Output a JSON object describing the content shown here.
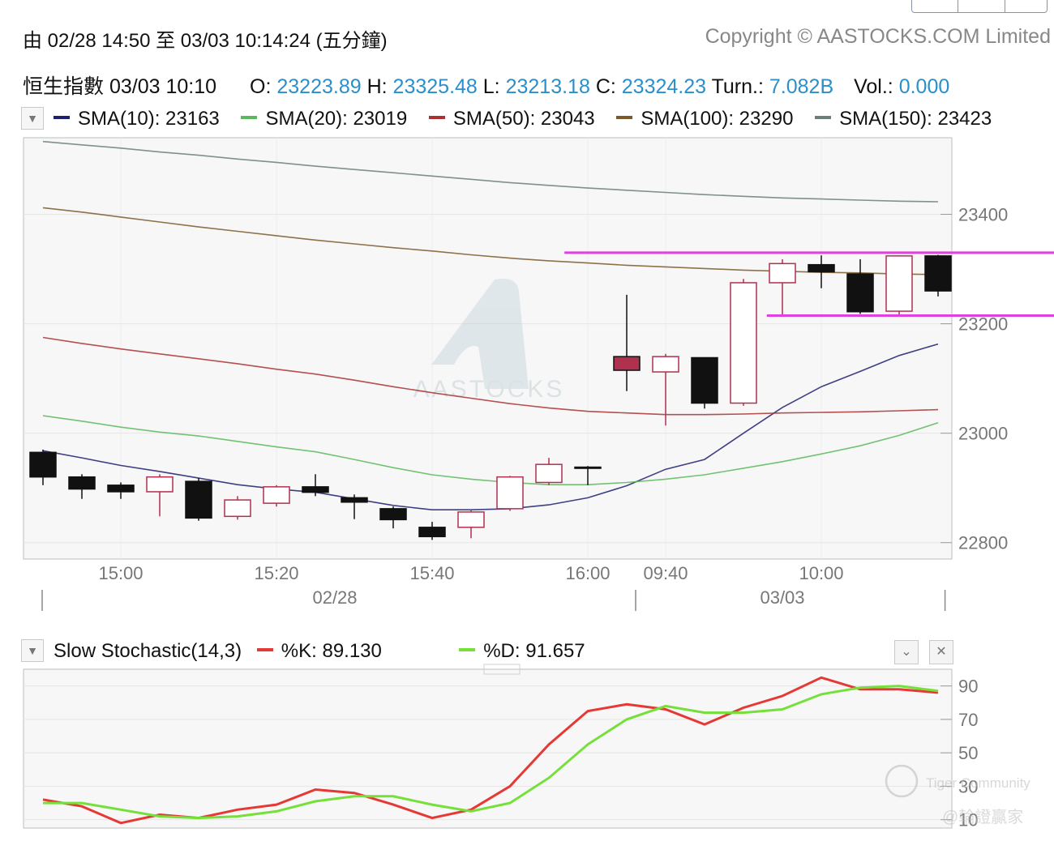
{
  "header": {
    "range": "由  02/28 14:50 至  03/03 10:14:24 (五分鐘)",
    "copyright": "Copyright © AASTOCKS.COM Limited"
  },
  "quote": {
    "name": "恒生指數",
    "time": "03/03 10:10",
    "open_label": "O:",
    "open": "23223.89",
    "high_label": "H:",
    "high": "23325.48",
    "low_label": "L:",
    "low": "23213.18",
    "close_label": "C:",
    "close": "23324.23",
    "turnover_label": "Turn.:",
    "turnover": "7.082B",
    "volume_label": "Vol.:",
    "volume": "0.000"
  },
  "sma_legend": [
    {
      "label": "SMA(10): 23163",
      "color": "#1f1f6e"
    },
    {
      "label": "SMA(20): 23019",
      "color": "#5cb85c"
    },
    {
      "label": "SMA(50): 23043",
      "color": "#a83232"
    },
    {
      "label": "SMA(100): 23290",
      "color": "#7a5a2a"
    },
    {
      "label": "SMA(150): 23423",
      "color": "#6a7f7a"
    }
  ],
  "watermark": "AASTOCKS",
  "stoch_legend": {
    "title": "Slow Stochastic(14,3)",
    "k_label": "%K: 89.130",
    "k_color": "#e53935",
    "d_label": "%D: 91.657",
    "d_color": "#76e03a"
  },
  "community_watermark": {
    "brand": "Tiger Community",
    "handle": "@輪證贏家"
  },
  "colors": {
    "up_candle": "#b03050",
    "down_candle": "#111111",
    "resistance_line": "#e040e0",
    "quote_value": "#2b8fc9",
    "axis_text": "#777777"
  },
  "chart_data": [
    {
      "type": "candlestick",
      "interval": "5 min",
      "ylim": [
        22770,
        23540
      ],
      "y_ticks": [
        22800,
        23000,
        23200,
        23400
      ],
      "x_tick_labels": [
        "15:00",
        "15:20",
        "15:40",
        "16:00",
        "09:40",
        "10:00"
      ],
      "x_tick_index": [
        2,
        6,
        10,
        14,
        16,
        20
      ],
      "date_labels": [
        "02/28",
        "03/03"
      ],
      "candles": [
        {
          "o": 22965,
          "h": 22970,
          "l": 22905,
          "c": 22920
        },
        {
          "o": 22920,
          "h": 22925,
          "l": 22880,
          "c": 22898
        },
        {
          "o": 22905,
          "h": 22910,
          "l": 22880,
          "c": 22893
        },
        {
          "o": 22893,
          "h": 22925,
          "l": 22848,
          "c": 22920
        },
        {
          "o": 22912,
          "h": 22918,
          "l": 22840,
          "c": 22845
        },
        {
          "o": 22848,
          "h": 22885,
          "l": 22842,
          "c": 22878
        },
        {
          "o": 22872,
          "h": 22905,
          "l": 22866,
          "c": 22902
        },
        {
          "o": 22902,
          "h": 22925,
          "l": 22885,
          "c": 22892
        },
        {
          "o": 22882,
          "h": 22888,
          "l": 22843,
          "c": 22874
        },
        {
          "o": 22862,
          "h": 22866,
          "l": 22826,
          "c": 22842
        },
        {
          "o": 22828,
          "h": 22838,
          "l": 22805,
          "c": 22811
        },
        {
          "o": 22828,
          "h": 22860,
          "l": 22808,
          "c": 22856
        },
        {
          "o": 22862,
          "h": 22922,
          "l": 22858,
          "c": 22920
        },
        {
          "o": 22910,
          "h": 22955,
          "l": 22905,
          "c": 22943
        },
        {
          "o": 22938,
          "h": 22940,
          "l": 22905,
          "c": 22937
        },
        {
          "o": 23140,
          "h": 23253,
          "l": 23077,
          "c": 23115
        },
        {
          "o": 23112,
          "h": 23145,
          "l": 23014,
          "c": 23140
        },
        {
          "o": 23138,
          "h": 23138,
          "l": 23045,
          "c": 23055
        },
        {
          "o": 23055,
          "h": 23282,
          "l": 23050,
          "c": 23275
        },
        {
          "o": 23275,
          "h": 23318,
          "l": 23213,
          "c": 23310
        },
        {
          "o": 23308,
          "h": 23325,
          "l": 23265,
          "c": 23295
        },
        {
          "o": 23291,
          "h": 23318,
          "l": 23218,
          "c": 23222
        },
        {
          "o": 23223,
          "h": 23325,
          "l": 23213,
          "c": 23324
        },
        {
          "o": 23324,
          "h": 23326,
          "l": 23250,
          "c": 23260
        }
      ],
      "sma": [
        {
          "name": "SMA(10)",
          "color": "#1f1f6e",
          "values": [
            22968,
            22955,
            22941,
            22930,
            22918,
            22906,
            22898,
            22892,
            22880,
            22868,
            22860,
            22860,
            22862,
            22869,
            22882,
            22904,
            22934,
            22952,
            23000,
            23047,
            23085,
            23113,
            23142,
            23163
          ]
        },
        {
          "name": "SMA(20)",
          "color": "#5cb85c",
          "values": [
            23032,
            23022,
            23011,
            23002,
            22995,
            22985,
            22975,
            22966,
            22952,
            22937,
            22924,
            22916,
            22910,
            22906,
            22906,
            22910,
            22916,
            22924,
            22936,
            22948,
            22962,
            22977,
            22996,
            23019
          ]
        },
        {
          "name": "SMA(50)",
          "color": "#a83232",
          "values": [
            23175,
            23164,
            23154,
            23145,
            23136,
            23127,
            23117,
            23108,
            23097,
            23085,
            23074,
            23064,
            23054,
            23046,
            23040,
            23037,
            23034,
            23034,
            23035,
            23037,
            23038,
            23039,
            23041,
            23043
          ]
        },
        {
          "name": "SMA(100)",
          "color": "#7a5a2a",
          "values": [
            23412,
            23404,
            23395,
            23386,
            23377,
            23369,
            23361,
            23353,
            23346,
            23339,
            23333,
            23326,
            23320,
            23315,
            23311,
            23307,
            23304,
            23301,
            23298,
            23296,
            23294,
            23293,
            23291,
            23290
          ]
        },
        {
          "name": "SMA(150)",
          "color": "#6a7f7a",
          "values": [
            23533,
            23527,
            23521,
            23514,
            23508,
            23501,
            23495,
            23488,
            23482,
            23476,
            23470,
            23464,
            23458,
            23453,
            23448,
            23444,
            23440,
            23436,
            23433,
            23430,
            23428,
            23426,
            23424,
            23423
          ]
        }
      ],
      "resistance_levels": [
        {
          "value": 23330,
          "from_index": 13.4,
          "color": "#e040e0"
        },
        {
          "value": 23215,
          "from_index": 18.6,
          "color": "#e040e0"
        }
      ]
    },
    {
      "type": "line",
      "title": "Slow Stochastic(14,3)",
      "ylim": [
        5,
        100
      ],
      "y_ticks": [
        10,
        30,
        50,
        70,
        90
      ],
      "series": [
        {
          "name": "%K",
          "color": "#e53935",
          "values": [
            22,
            18,
            8,
            13,
            11,
            16,
            19,
            28,
            26,
            19,
            11,
            16,
            30,
            55,
            75,
            79,
            76,
            67,
            77,
            84,
            95,
            88,
            88,
            86
          ]
        },
        {
          "name": "%D",
          "color": "#76e03a",
          "values": [
            20,
            20,
            16,
            12,
            11,
            12,
            15,
            21,
            24,
            24,
            19,
            15,
            20,
            35,
            55,
            70,
            78,
            74,
            74,
            76,
            85,
            89,
            90,
            87
          ]
        }
      ]
    }
  ]
}
